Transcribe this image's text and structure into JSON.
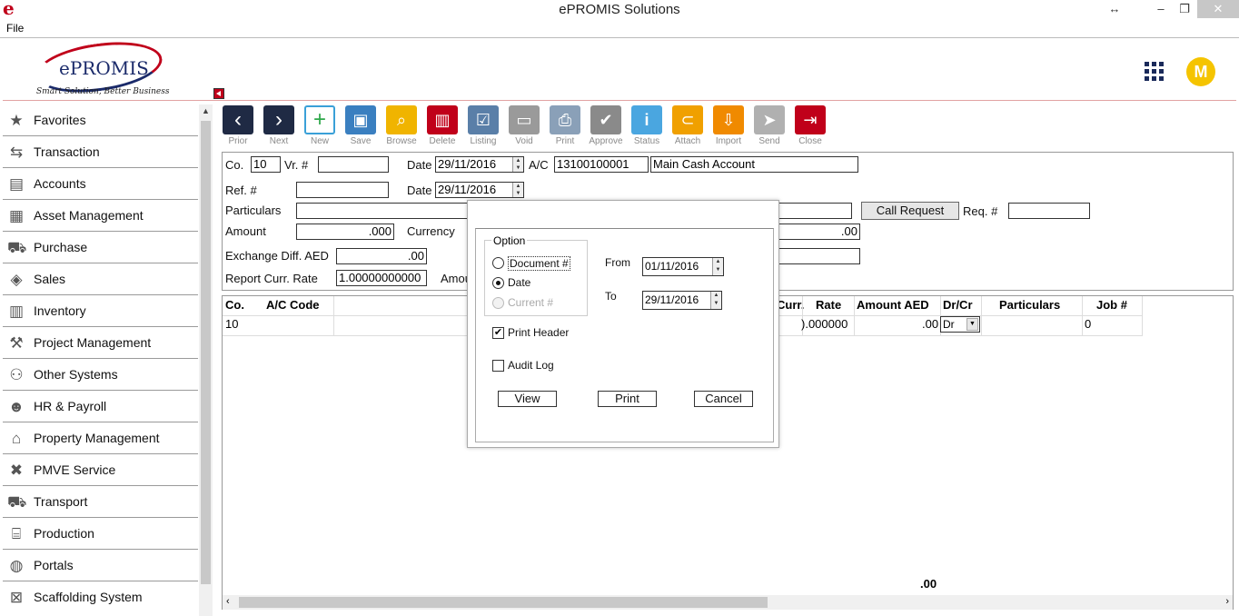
{
  "window": {
    "title": "ePROMIS Solutions",
    "app_icon": "e",
    "controls": {
      "resize": "↔",
      "minimize": "–",
      "restore": "❐",
      "close": "✕"
    }
  },
  "menu": {
    "file": "File"
  },
  "header": {
    "logo_text": "ePROMIS",
    "logo_tagline": "Smart Solution, Better Business",
    "avatar_letter": "M"
  },
  "sidebar": {
    "items": [
      {
        "label": "Favorites",
        "icon": "star-icon"
      },
      {
        "label": "Transaction",
        "icon": "transfer-icon"
      },
      {
        "label": "Accounts",
        "icon": "ledger-icon"
      },
      {
        "label": "Asset Management",
        "icon": "building-icon"
      },
      {
        "label": "Purchase",
        "icon": "cart-icon"
      },
      {
        "label": "Sales",
        "icon": "tag-icon"
      },
      {
        "label": "Inventory",
        "icon": "forklift-icon"
      },
      {
        "label": "Project Management",
        "icon": "project-icon"
      },
      {
        "label": "Other Systems",
        "icon": "network-icon"
      },
      {
        "label": "HR & Payroll",
        "icon": "people-icon"
      },
      {
        "label": "Property Management",
        "icon": "property-icon"
      },
      {
        "label": "PMVE Service",
        "icon": "tools-icon"
      },
      {
        "label": "Transport",
        "icon": "truck-icon"
      },
      {
        "label": "Production",
        "icon": "factory-icon"
      },
      {
        "label": "Portals",
        "icon": "globe-icon"
      },
      {
        "label": "Scaffolding System",
        "icon": "scaffold-icon"
      }
    ]
  },
  "toolbar": {
    "buttons": [
      {
        "label": "Prior",
        "icon": "chevron-left-icon",
        "color": "#1f2a44"
      },
      {
        "label": "Next",
        "icon": "chevron-right-icon",
        "color": "#1f2a44"
      },
      {
        "label": "New",
        "icon": "new-document-icon",
        "color": "#3aa0d8"
      },
      {
        "label": "Save",
        "icon": "floppy-icon",
        "color": "#3a7fc0"
      },
      {
        "label": "Browse",
        "icon": "folder-search-icon",
        "color": "#f0b400"
      },
      {
        "label": "Delete",
        "icon": "trash-icon",
        "color": "#c0001a"
      },
      {
        "label": "Listing",
        "icon": "checklist-icon",
        "color": "#5a7fa8"
      },
      {
        "label": "Void",
        "icon": "void-icon",
        "color": "#9a9a9a"
      },
      {
        "label": "Print",
        "icon": "printer-icon",
        "color": "#8aa0b8"
      },
      {
        "label": "Approve",
        "icon": "approve-icon",
        "color": "#8a8a8a"
      },
      {
        "label": "Status",
        "icon": "info-icon",
        "color": "#4aa6e0"
      },
      {
        "label": "Attach",
        "icon": "paperclip-icon",
        "color": "#f0a000"
      },
      {
        "label": "Import",
        "icon": "import-icon",
        "color": "#f08a00"
      },
      {
        "label": "Send",
        "icon": "paper-plane-icon",
        "color": "#b0b0b0"
      },
      {
        "label": "Close",
        "icon": "exit-icon",
        "color": "#c0001a"
      }
    ]
  },
  "form": {
    "co_label": "Co.",
    "co_value": "10",
    "vr_label": "Vr. #",
    "vr_value": "",
    "date_label": "Date",
    "date_value": "29/11/2016",
    "ac_label": "A/C",
    "ac_code": "13100100001",
    "ac_name": "Main Cash Account",
    "ref_label": "Ref. #",
    "ref_value": "",
    "ref_date_label": "Date",
    "ref_date_value": "29/11/2016",
    "particulars_label": "Particulars",
    "particulars_value": "",
    "call_request": "Call Request",
    "req_label": "Req. #",
    "req_value": "",
    "amount_label": "Amount",
    "amount_value": ".000",
    "currency_label": "Currency",
    "right_amount_value": ".00",
    "exch_label": "Exchange Diff. AED",
    "exch_value": ".00",
    "report_rate_label": "Report Curr. Rate",
    "report_rate_value": "1.00000000000",
    "amou_label": "Amou"
  },
  "grid": {
    "headers": {
      "co": "Co.",
      "ac_code": "A/C Code",
      "curr": "Curr.",
      "rate": "Rate",
      "amount_aed": "Amount AED",
      "dr_cr": "Dr/Cr",
      "particulars": "Particulars",
      "job": "Job #"
    },
    "row": {
      "co": "10",
      "rate": ").000000",
      "amount_aed": ".00",
      "dr_cr": "Dr",
      "job": "0"
    },
    "total": ".00"
  },
  "dialog": {
    "option_label": "Option",
    "document_label": "Document #",
    "date_label": "Date",
    "current_label": "Current #",
    "from_label": "From",
    "from_value": "01/11/2016",
    "to_label": "To",
    "to_value": "29/11/2016",
    "print_header": "Print Header",
    "audit_log": "Audit Log",
    "view_btn": "View",
    "print_btn": "Print",
    "cancel_btn": "Cancel"
  }
}
